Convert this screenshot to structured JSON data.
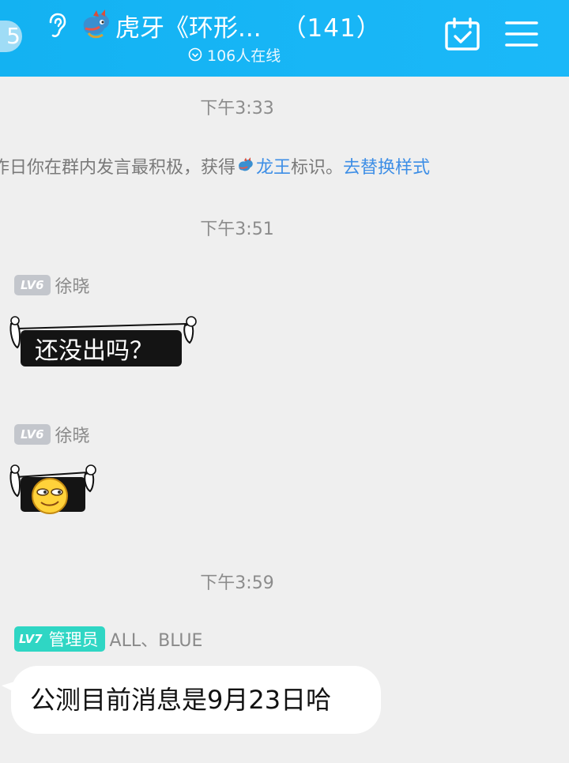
{
  "header": {
    "back_badge": "5",
    "title": "虎牙《环形...",
    "member_count": "（141）",
    "online_text": "106人在线",
    "bg_color": "#13b2f2",
    "icons": [
      "ear-icon",
      "dragon-icon",
      "online-check-icon",
      "calendar-check-icon",
      "menu-icon"
    ]
  },
  "chat": {
    "timestamps": [
      "下午3:33",
      "下午3:51",
      "下午3:59"
    ],
    "system_message": {
      "prefix": "作日你在群内发言最积极，获得",
      "highlight": "龙王",
      "middle": "标识。",
      "link": "去替换样式"
    },
    "messages": [
      {
        "level": "LV6",
        "sender": "徐晓",
        "sticker_text": "还没出吗？"
      },
      {
        "level": "LV6",
        "sender": "徐晓",
        "sticker": "smirk-emoji-sticker"
      },
      {
        "level": "LV7",
        "role": "管理员",
        "sender": "ALL、BLUE",
        "text": "公测目前消息是9月23日哈"
      }
    ]
  }
}
